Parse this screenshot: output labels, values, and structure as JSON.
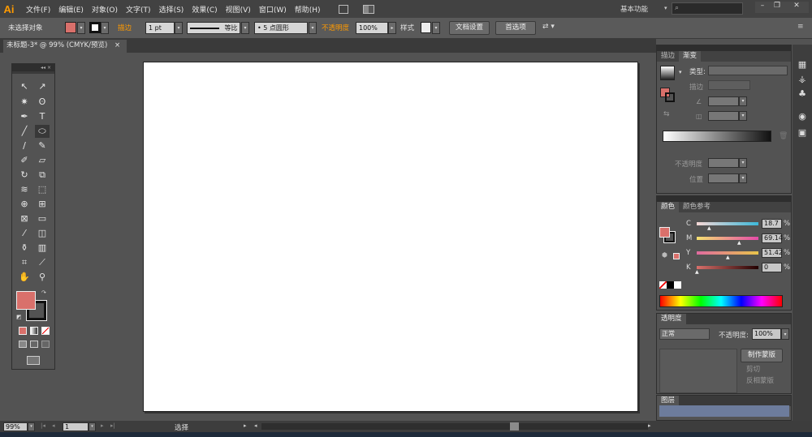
{
  "app": {
    "logo": "Ai"
  },
  "menu": [
    "文件(F)",
    "编辑(E)",
    "对象(O)",
    "文字(T)",
    "选择(S)",
    "效果(C)",
    "视图(V)",
    "窗口(W)",
    "帮助(H)"
  ],
  "workspace": {
    "label": "基本功能",
    "search_placeholder": ""
  },
  "control": {
    "selection_status": "未选择对象",
    "stroke_label": "描边",
    "stroke_weight": "1 pt",
    "stroke_profile": "等比",
    "brush": "5 点圆形",
    "opacity_label": "不透明度",
    "opacity_value": "100%",
    "style_label": "样式",
    "doc_setup_button": "文档设置",
    "prefs_button": "首选项"
  },
  "document_tab": {
    "title": "未标题-3* @ 99% (CMYK/预览)",
    "close": "×"
  },
  "status": {
    "zoom": "99%",
    "page": "1",
    "tool_label": "选择"
  },
  "gradient_panel": {
    "tabs": [
      "描边",
      "渐变"
    ],
    "type_label": "类型:",
    "stroke_label": "描边",
    "opacity_label": "不透明度",
    "location_label": "位置"
  },
  "color_panel": {
    "tabs": [
      "颜色",
      "颜色参考"
    ],
    "channels": [
      {
        "label": "C",
        "value": "18.7",
        "pct": 0.187
      },
      {
        "label": "M",
        "value": "69.14",
        "pct": 0.691
      },
      {
        "label": "Y",
        "value": "51.42",
        "pct": 0.514
      },
      {
        "label": "K",
        "value": "0",
        "pct": 0
      }
    ],
    "unit": "%"
  },
  "transparency_panel": {
    "tab": "透明度",
    "blend_mode": "正常",
    "opacity_label": "不透明度:",
    "opacity_value": "100%",
    "make_mask_button": "制作蒙版",
    "clip_label": "剪切",
    "invert_label": "反相蒙版"
  },
  "layers_panel": {
    "tab": "图层"
  },
  "colors": {
    "fill": "#d9706b",
    "accent": "#ff9a00"
  }
}
